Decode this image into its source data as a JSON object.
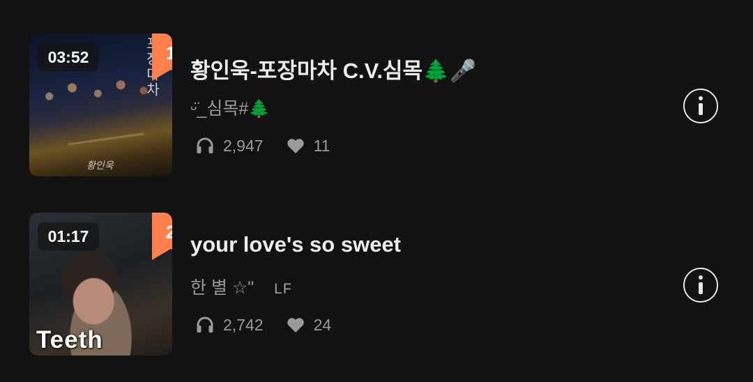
{
  "tracks": [
    {
      "rank": "1",
      "duration": "03:52",
      "title": "황인욱-포장마차 C.V.심목🌲🎤",
      "artist": "ᵕ̈_심목#🌲",
      "artist_extra": "",
      "plays": "2,947",
      "likes": "11",
      "cover": {
        "script": "포장마차",
        "sign": "황인욱",
        "caption": ""
      }
    },
    {
      "rank": "2",
      "duration": "01:17",
      "title": "your love's so sweet",
      "artist": "한 별 ☆\"",
      "artist_extra": "LF",
      "plays": "2,742",
      "likes": "24",
      "cover": {
        "script": "",
        "sign": "",
        "caption": "Teeth"
      }
    }
  ],
  "icons": {
    "plays": "headphones-icon",
    "likes": "heart-icon",
    "info": "info-icon"
  },
  "colors": {
    "background": "#121212",
    "rank_badge": "#ff7f4d",
    "title_text": "#ededed",
    "secondary_text": "#9a9a9a"
  }
}
